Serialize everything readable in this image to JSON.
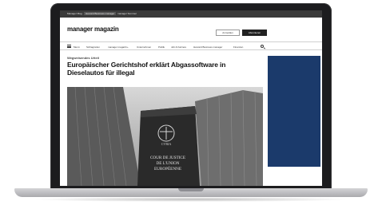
{
  "topbar": {
    "link1": "Manager Mag.",
    "link2": "Harvard Business manager",
    "link3": "manager Sommer"
  },
  "brand": {
    "name": "manager magazin"
  },
  "actions": {
    "login_label": "Anmelden",
    "subscribe_label": "Abonnieren"
  },
  "nav": {
    "items": [
      "Menü",
      "Schlagzeilen",
      "manager magazin+",
      "Unternehmen",
      "Politik",
      "Job & Karriere",
      "Harvard Business manager",
      "Finanzen"
    ]
  },
  "article": {
    "kicker": "Wegweisendes Urteil",
    "headline": "Europäischer Gerichtshof erklärt Abgassoftware in Dieselautos für illegal",
    "sign_text": "COUR DE JUSTICE DE L'UNION EUROPÉENNE",
    "sign_line1": "COUR DE JUSTICE",
    "sign_line2": "DE L'UNION",
    "sign_line3": "EUROPÉENNE",
    "sign_emblem": "CVRIA"
  },
  "colors": {
    "ad_panel": "#1b3a6b",
    "laptop_bezel": "#1c1c1e"
  }
}
